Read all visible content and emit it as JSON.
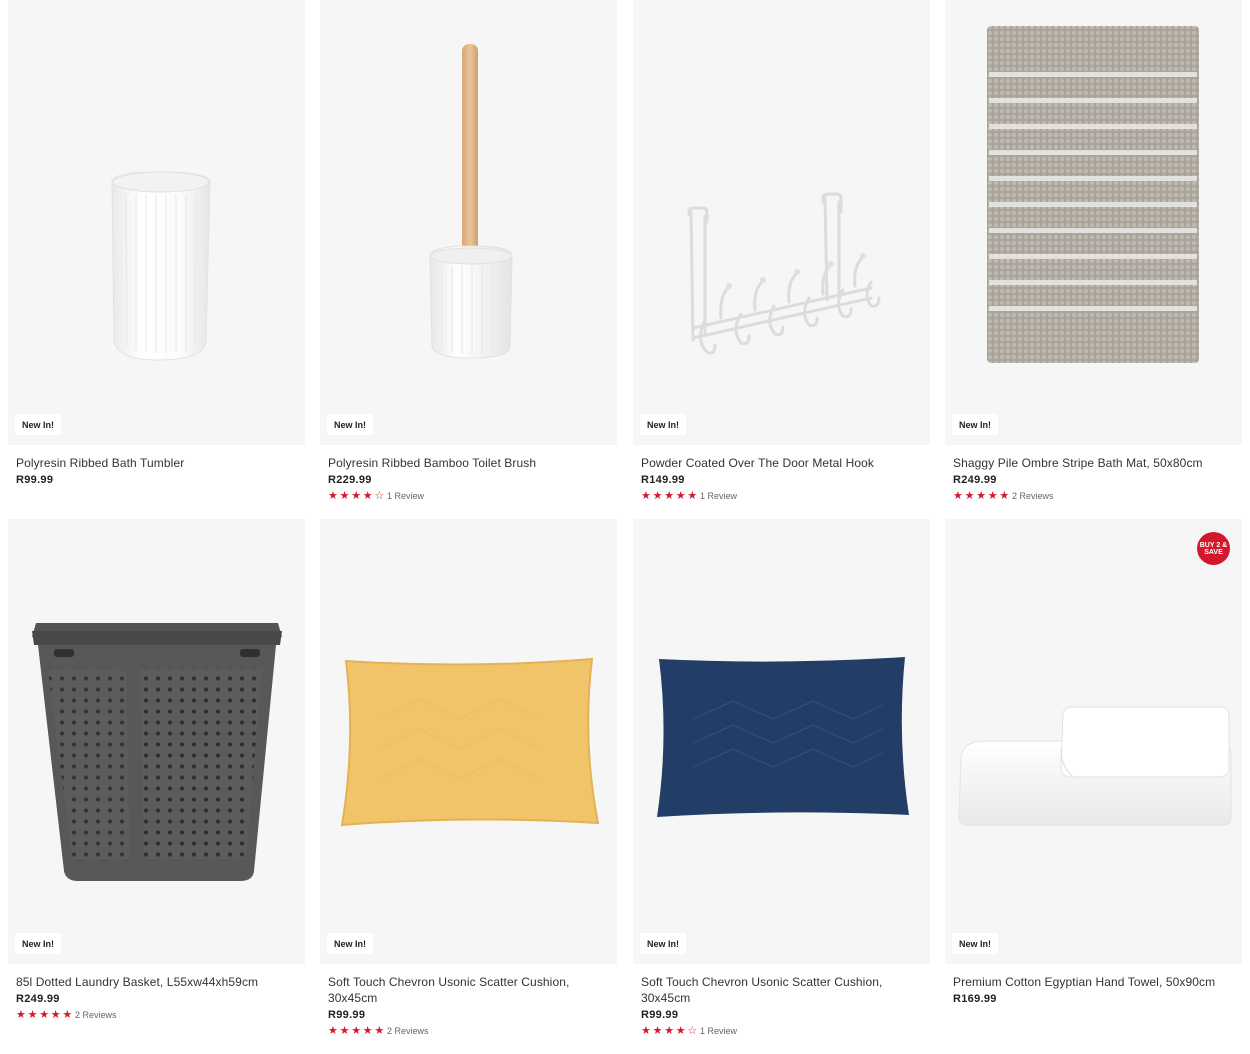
{
  "colors": {
    "accent": "#d4182b",
    "card_bg": "#f6f6f6"
  },
  "products": [
    {
      "title": "Polyresin Ribbed Bath Tumbler",
      "price": "R99.99",
      "badge": "New In!",
      "rating": 0,
      "reviews": ""
    },
    {
      "title": "Polyresin Ribbed Bamboo Toilet Brush",
      "price": "R229.99",
      "badge": "New In!",
      "rating": 4,
      "reviews": "1 Review"
    },
    {
      "title": "Powder Coated Over The Door Metal Hook",
      "price": "R149.99",
      "badge": "New In!",
      "rating": 5,
      "reviews": "1 Review"
    },
    {
      "title": "Shaggy Pile Ombre Stripe Bath Mat, 50x80cm",
      "price": "R249.99",
      "badge": "New In!",
      "rating": 5,
      "reviews": "2 Reviews"
    },
    {
      "title": "85l Dotted Laundry Basket, L55xw44xh59cm",
      "price": "R249.99",
      "badge": "New In!",
      "rating": 5,
      "reviews": "2 Reviews"
    },
    {
      "title": "Soft Touch Chevron Usonic Scatter Cushion, 30x45cm",
      "price": "R99.99",
      "badge": "New In!",
      "rating": 5,
      "reviews": "2 Reviews"
    },
    {
      "title": "Soft Touch Chevron Usonic Scatter Cushion, 30x45cm",
      "price": "R99.99",
      "badge": "New In!",
      "rating": 4,
      "reviews": "1 Review"
    },
    {
      "title": "Premium Cotton Egyptian Hand Towel, 50x90cm",
      "price": "R169.99",
      "badge": "New In!",
      "rating": 0,
      "reviews": "",
      "promo": "BUY 2 & SAVE"
    }
  ]
}
